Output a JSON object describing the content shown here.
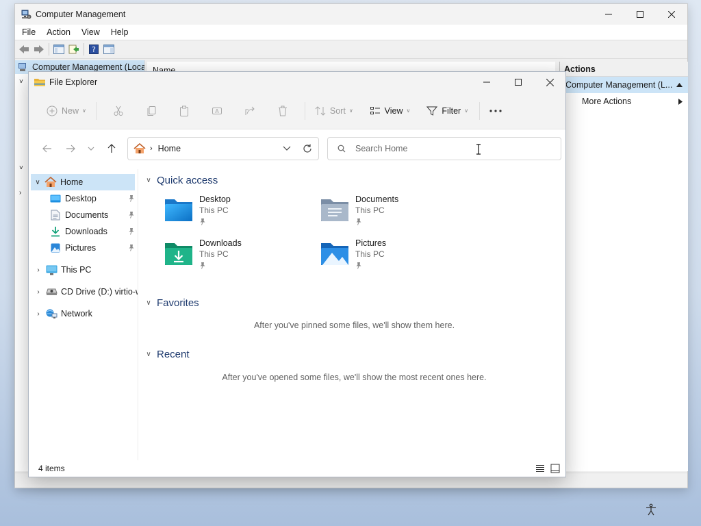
{
  "computer_management": {
    "title": "Computer Management",
    "menu": [
      "File",
      "Action",
      "View",
      "Help"
    ],
    "tree_root": "Computer Management (Local",
    "column_header": "Name",
    "actions_header": "Actions",
    "actions_selected": "Computer Management (L...",
    "more_actions": "More Actions"
  },
  "file_explorer": {
    "title": "File Explorer",
    "commands": {
      "new": "New",
      "sort": "Sort",
      "view": "View",
      "filter": "Filter",
      "more": "..."
    },
    "address": {
      "crumb": "Home"
    },
    "search": {
      "placeholder": "Search Home"
    },
    "nav_pane": {
      "home": "Home",
      "pinned": [
        {
          "label": "Desktop",
          "icon": "desktop-icon"
        },
        {
          "label": "Documents",
          "icon": "documents-icon"
        },
        {
          "label": "Downloads",
          "icon": "downloads-icon"
        },
        {
          "label": "Pictures",
          "icon": "pictures-icon"
        }
      ],
      "roots": [
        {
          "label": "This PC",
          "icon": "this-pc-icon"
        },
        {
          "label": "CD Drive (D:) virtio-w",
          "icon": "cd-drive-icon"
        },
        {
          "label": "Network",
          "icon": "network-icon"
        }
      ]
    },
    "quick_access": {
      "header": "Quick access",
      "items": [
        {
          "name": "Desktop",
          "location": "This PC",
          "icon": "desktop-folder-icon"
        },
        {
          "name": "Documents",
          "location": "This PC",
          "icon": "documents-folder-icon"
        },
        {
          "name": "Downloads",
          "location": "This PC",
          "icon": "downloads-folder-icon"
        },
        {
          "name": "Pictures",
          "location": "This PC",
          "icon": "pictures-folder-icon"
        }
      ]
    },
    "favorites": {
      "header": "Favorites",
      "empty_text": "After you've pinned some files, we'll show them here."
    },
    "recent": {
      "header": "Recent",
      "empty_text": "After you've opened some files, we'll show the most recent ones here."
    },
    "status": "4 items"
  },
  "colors": {
    "selection": "#cce4f7",
    "group_header": "#1e3a6e",
    "accent": "#0067c0"
  }
}
